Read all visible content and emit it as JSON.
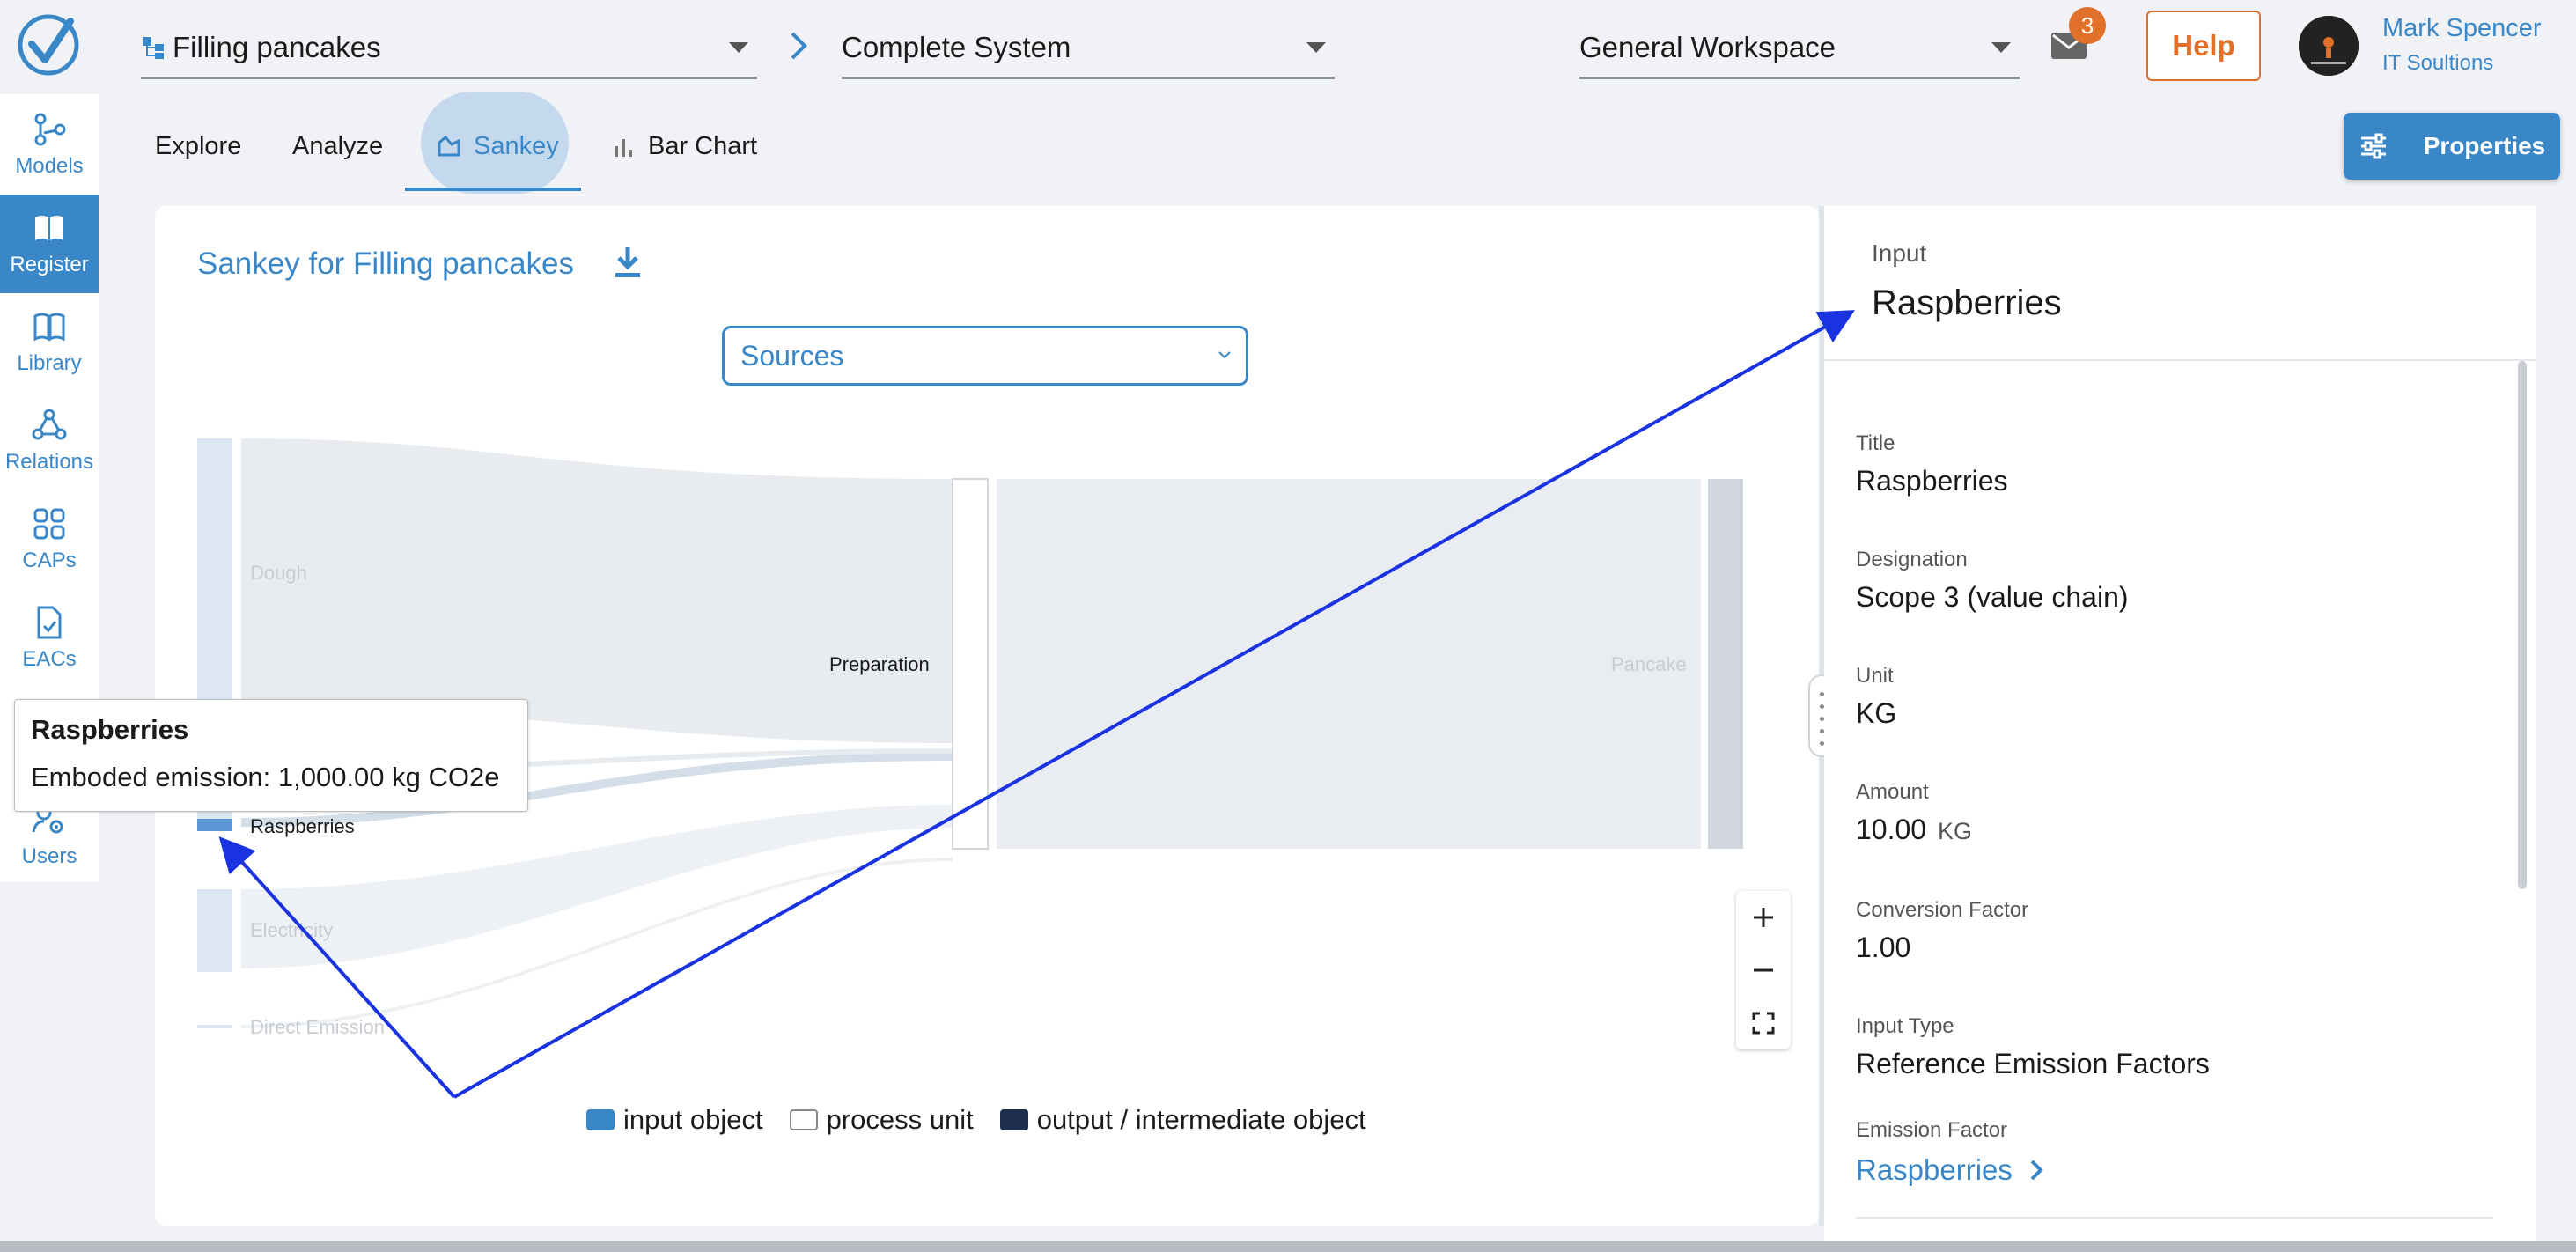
{
  "header": {
    "model_select": "Filling pancakes",
    "scope_select": "Complete System",
    "workspace_select": "General Workspace",
    "mail_count": "3",
    "help_label": "Help",
    "user_name": "Mark Spencer",
    "user_org": "IT Soultions"
  },
  "nav": {
    "items": [
      {
        "label": "Models",
        "icon": "models-icon"
      },
      {
        "label": "Register",
        "icon": "book-icon",
        "active": true
      },
      {
        "label": "Library",
        "icon": "library-icon"
      },
      {
        "label": "Relations",
        "icon": "relations-icon"
      },
      {
        "label": "CAPs",
        "icon": "grid-icon"
      },
      {
        "label": "EACs",
        "icon": "document-check-icon"
      },
      {
        "label": "Users",
        "icon": "user-settings-icon"
      }
    ]
  },
  "tabs": {
    "explore": "Explore",
    "analyze": "Analyze",
    "sankey": "Sankey",
    "bar_chart": "Bar Chart",
    "active": "Sankey"
  },
  "properties_label": "Properties",
  "sankey": {
    "title": "Sankey for Filling pancakes",
    "view_select": "Sources",
    "nodes": {
      "dough": "Dough",
      "raspberries": "Raspberries",
      "electricity": "Electricity",
      "direct_emission": "Direct Emission",
      "preparation": "Preparation",
      "pancake": "Pancake"
    },
    "legend": {
      "input": "input object",
      "process": "process unit",
      "output": "output / intermediate object"
    },
    "colors": {
      "input": "#3a87c8",
      "output": "#1e2e4f",
      "link": "#e8ecf1",
      "link_highlight": "#d5e0ea"
    }
  },
  "tooltip": {
    "title": "Raspberries",
    "body": "Emboded emission: 1,000.00 kg CO2e"
  },
  "panel": {
    "kind": "Input",
    "title": "Raspberries",
    "fields": {
      "title_label": "Title",
      "title_value": "Raspberries",
      "designation_label": "Designation",
      "designation_value": "Scope 3 (value chain)",
      "unit_label": "Unit",
      "unit_value": "KG",
      "amount_label": "Amount",
      "amount_value": "10.00",
      "amount_unit": "KG",
      "conversion_label": "Conversion Factor",
      "conversion_value": "1.00",
      "input_type_label": "Input Type",
      "input_type_value": "Reference Emission Factors",
      "emission_factor_label": "Emission Factor",
      "emission_factor_value": "Raspberries"
    }
  }
}
